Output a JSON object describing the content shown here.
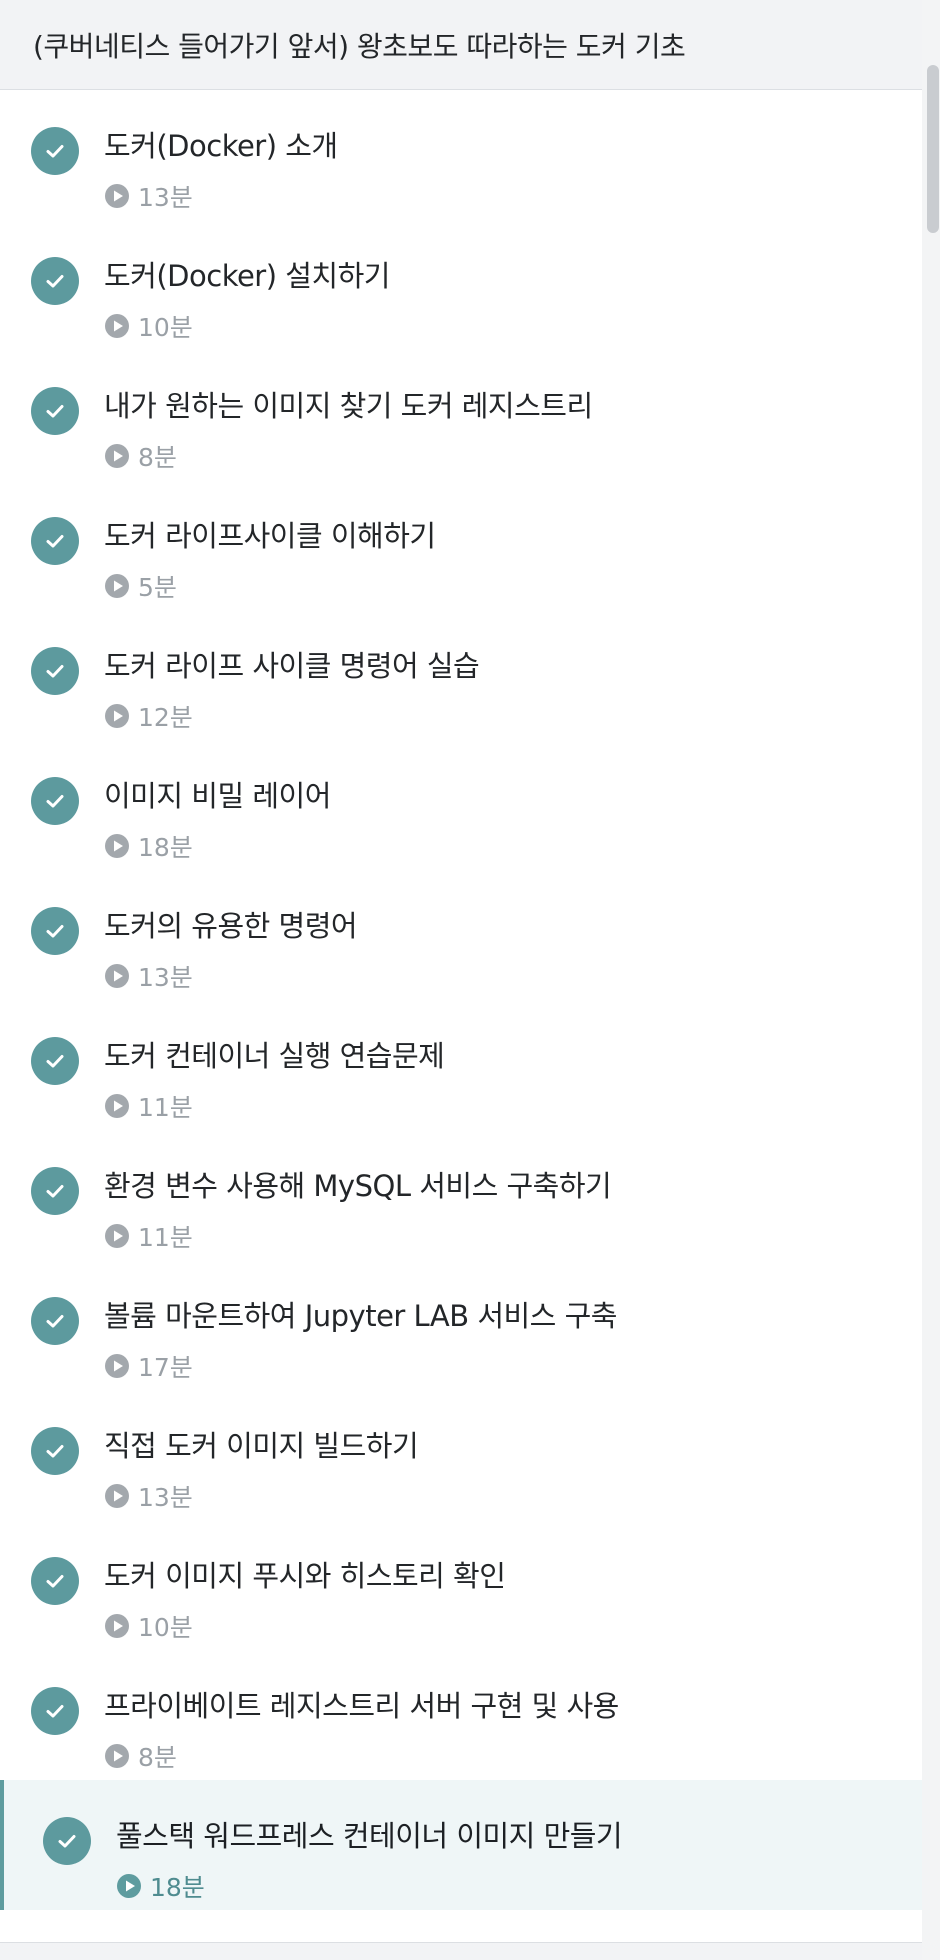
{
  "header": {
    "title": "(쿠버네티스 들어가기 앞서) 왕초보도 따라하는 도커 기초"
  },
  "icons": {
    "completed": "check-circle-icon",
    "duration": "play-circle-icon"
  },
  "colors": {
    "check_bg": "#5d9a9e",
    "active_bg": "#eff6f7",
    "active_accent": "#5e9c9f",
    "muted_text": "#9aa0a6"
  },
  "lessons": [
    {
      "title": "도커(Docker) 소개",
      "duration": "13분",
      "completed": true,
      "active": false
    },
    {
      "title": "도커(Docker) 설치하기",
      "duration": "10분",
      "completed": true,
      "active": false
    },
    {
      "title": "내가 원하는 이미지 찾기 도커 레지스트리",
      "duration": "8분",
      "completed": true,
      "active": false
    },
    {
      "title": "도커 라이프사이클 이해하기",
      "duration": "5분",
      "completed": true,
      "active": false
    },
    {
      "title": "도커 라이프 사이클 명령어 실습",
      "duration": "12분",
      "completed": true,
      "active": false
    },
    {
      "title": "이미지 비밀 레이어",
      "duration": "18분",
      "completed": true,
      "active": false
    },
    {
      "title": "도커의 유용한 명령어",
      "duration": "13분",
      "completed": true,
      "active": false
    },
    {
      "title": "도커 컨테이너 실행 연습문제",
      "duration": "11분",
      "completed": true,
      "active": false
    },
    {
      "title": "환경 변수 사용해 MySQL 서비스 구축하기",
      "duration": "11분",
      "completed": true,
      "active": false
    },
    {
      "title": "볼륨 마운트하여 Jupyter LAB 서비스 구축",
      "duration": "17분",
      "completed": true,
      "active": false
    },
    {
      "title": "직접 도커 이미지 빌드하기",
      "duration": "13분",
      "completed": true,
      "active": false
    },
    {
      "title": "도커 이미지 푸시와 히스토리 확인",
      "duration": "10분",
      "completed": true,
      "active": false
    },
    {
      "title": "프라이베이트 레지스트리 서버 구현 및 사용",
      "duration": "8분",
      "completed": true,
      "active": false
    },
    {
      "title": "풀스택 워드프레스 컨테이너 이미지 만들기",
      "duration": "18분",
      "completed": true,
      "active": true
    }
  ]
}
